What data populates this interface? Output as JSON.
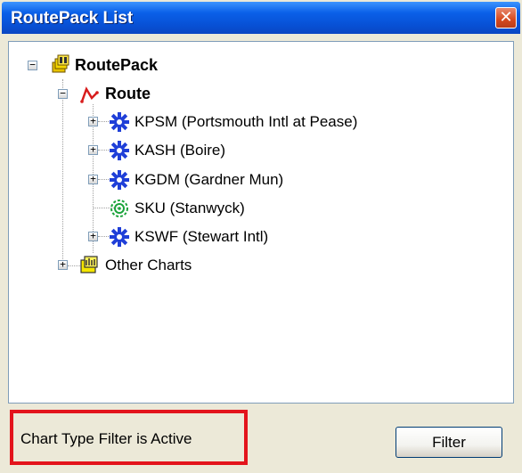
{
  "window": {
    "title": "RoutePack List",
    "close_glyph": "✕"
  },
  "tree": {
    "root": {
      "label": "RoutePack",
      "icon": "routepack-icon",
      "expander": "−"
    },
    "route": {
      "label": "Route",
      "icon": "route-icon",
      "expander": "−"
    },
    "waypoints": [
      {
        "label": "KPSM (Portsmouth Intl at Pease)",
        "icon": "airport-icon",
        "expander": "+"
      },
      {
        "label": "KASH (Boire)",
        "icon": "airport-icon",
        "expander": "+"
      },
      {
        "label": "KGDM (Gardner Mun)",
        "icon": "airport-icon",
        "expander": "+"
      },
      {
        "label": "SKU (Stanwyck)",
        "icon": "vor-icon",
        "expander": ""
      },
      {
        "label": "KSWF (Stewart Intl)",
        "icon": "airport-icon",
        "expander": "+"
      }
    ],
    "other": {
      "label": "Other Charts",
      "icon": "charts-folder-icon",
      "expander": "+"
    }
  },
  "status": {
    "filter_text": "Chart Type Filter is Active",
    "highlight_color": "#e3141c"
  },
  "buttons": {
    "filter_label": "Filter"
  },
  "colors": {
    "title_bar": "#0a5fe8",
    "window_bg": "#ece9d8",
    "airport_icon": "#1f3fd8",
    "vor_icon": "#1aa33a",
    "route_icon": "#d81c1c"
  }
}
